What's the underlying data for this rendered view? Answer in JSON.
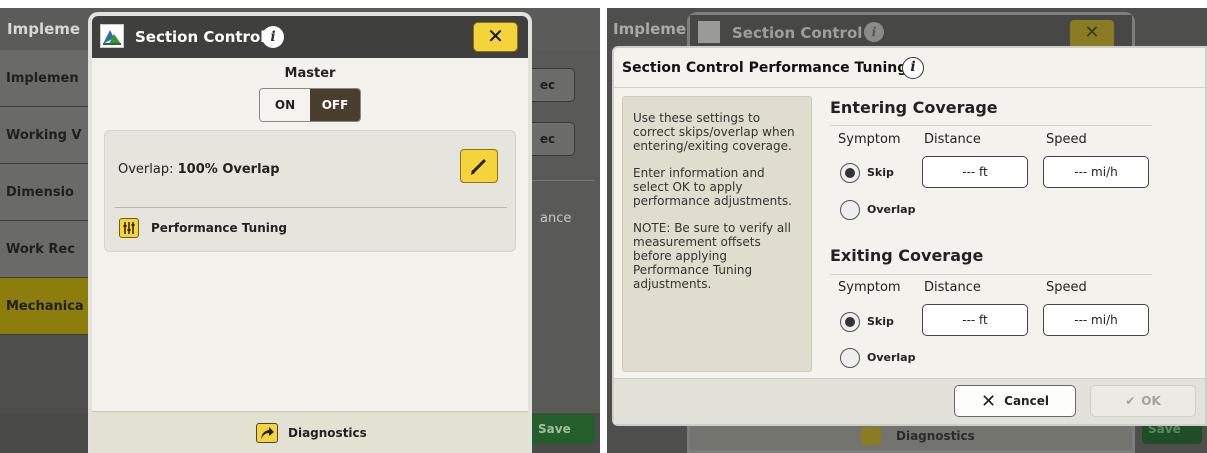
{
  "left": {
    "background": {
      "title": "Impleme",
      "menu": [
        "Implemen",
        "Working V",
        "Dimensio",
        "Work Rec",
        "Mechanica"
      ],
      "right_buttons": [
        "ec",
        "ec"
      ],
      "right_text": "ance",
      "save_label": "Save"
    },
    "dialog": {
      "title": "Section Control",
      "info_glyph": "i",
      "close_glyph": "✕",
      "master_label": "Master",
      "on_label": "ON",
      "off_label": "OFF",
      "overlap_prefix": "Overlap: ",
      "overlap_value": "100% Overlap",
      "performance_tuning_label": "Performance Tuning",
      "diagnostics_label": "Diagnostics"
    }
  },
  "right": {
    "background": {
      "title": "Impleme",
      "dialog_title": "Section Control",
      "info_glyph": "i",
      "close_glyph": "✕",
      "diagnostics_label": "Diagnostics",
      "save_label": "Save"
    },
    "tuning": {
      "title": "Section Control Performance Tuning",
      "info_glyph": "i",
      "help": [
        "Use these settings to correct skips/overlap when entering/exiting coverage.",
        "Enter information and select OK to apply performance adjustments.",
        "NOTE: Be sure to verify all measurement offsets before applying Performance Tuning adjustments."
      ],
      "entering": {
        "title": "Entering Coverage",
        "symptom_header": "Symptom",
        "distance_header": "Distance",
        "speed_header": "Speed",
        "skip_label": "Skip",
        "overlap_label": "Overlap",
        "selected": "Skip",
        "distance_value": "--- ft",
        "speed_value": "--- mi/h"
      },
      "exiting": {
        "title": "Exiting Coverage",
        "symptom_header": "Symptom",
        "distance_header": "Distance",
        "speed_header": "Speed",
        "skip_label": "Skip",
        "overlap_label": "Overlap",
        "selected": "Skip",
        "distance_value": "--- ft",
        "speed_value": "--- mi/h"
      },
      "cancel_label": "Cancel",
      "ok_label": "OK"
    }
  },
  "colors": {
    "accent_yellow": "#f5d33a",
    "title_bar": "#3f3f3d",
    "dialog_bg": "#f3f2ec",
    "toggle_off_bg": "#4a3f2c",
    "save_green": "#245e2b"
  },
  "icons": [
    "app-logo-icon",
    "info-icon",
    "close-icon",
    "pencil-icon",
    "sliders-icon",
    "diagnostics-arrow-icon",
    "cancel-x-icon",
    "checkmark-icon",
    "radio-icon"
  ]
}
